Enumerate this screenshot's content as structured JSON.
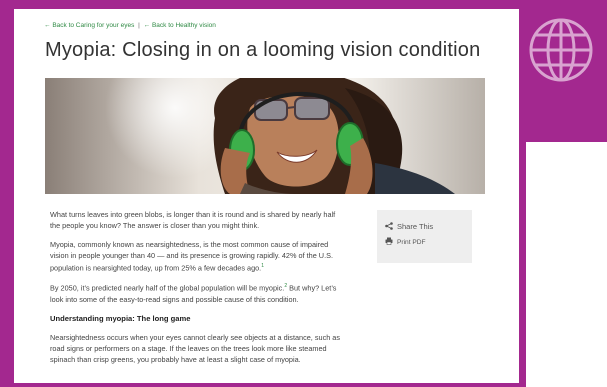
{
  "breadcrumbs": {
    "back_caring": "Back to Caring for your eyes",
    "separator": "|",
    "back_healthy": "Back to Healthy vision"
  },
  "article": {
    "title": "Myopia: Closing in on a looming vision condition",
    "para1": "What turns leaves into green blobs, is longer than it is round and is shared by nearly half the people you know? The answer is closer than you might think.",
    "para2_text": "Myopia, commonly known as nearsightedness, is the most common cause of impaired vision in people younger than 40 — and its presence is growing rapidly. 42% of the U.S. population is nearsighted today, up from 25% a few decades ago.",
    "para2_ref": "1",
    "para3_a": "By 2050, it’s predicted nearly half of the global population will be myopic.",
    "para3_ref": "2",
    "para3_b": " But why? Let’s look into some of the easy-to-read signs and possible cause of this condition.",
    "section_heading": "Understanding myopia: The long game",
    "para4": "Nearsightedness occurs when your eyes cannot clearly see objects at a distance, such as road signs or performers on a stage. If the leaves on the trees look more like steamed spinach than crisp greens, you probably have at least a slight case of myopia."
  },
  "share": {
    "share_label": "Share This",
    "print_label": "Print PDF",
    "share_icon": "share-icon",
    "print_icon": "printer-icon"
  },
  "colors": {
    "frame": "#a3288f",
    "link_green": "#2f8a44",
    "share_bg": "#eeeeee"
  }
}
